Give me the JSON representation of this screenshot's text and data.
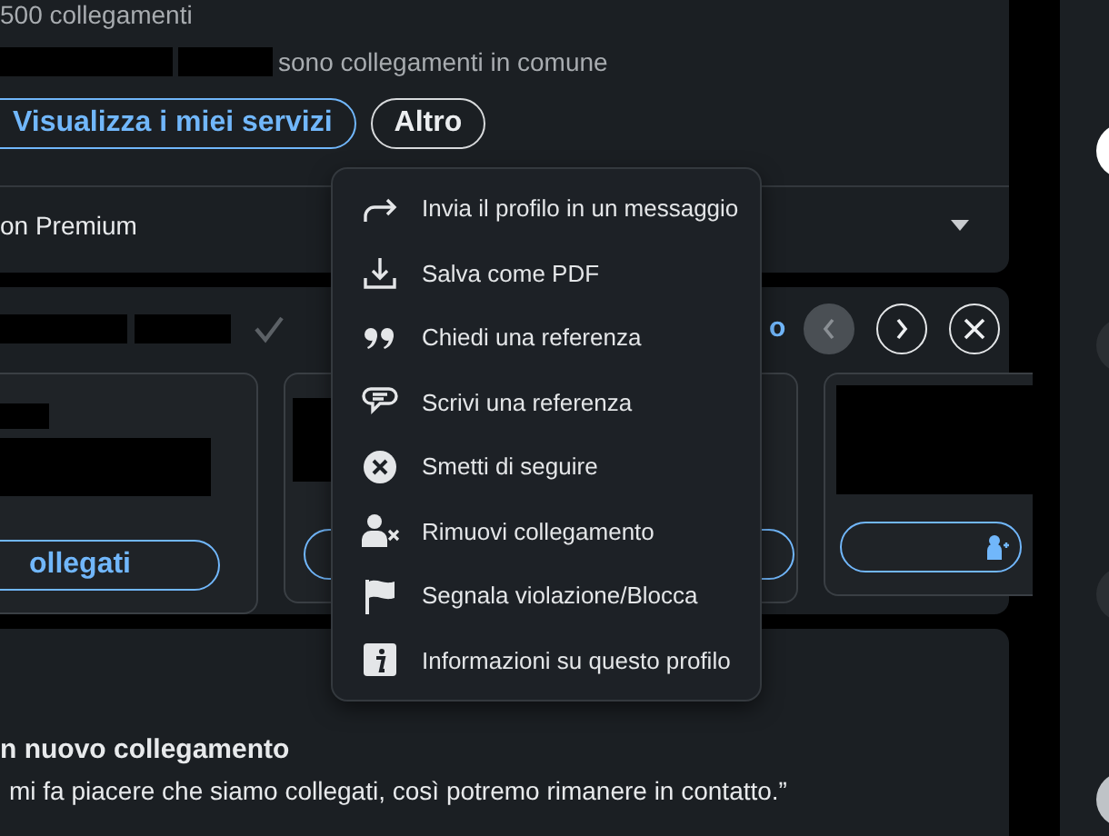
{
  "profile": {
    "connections": "500 collegamenti",
    "mutual_text": "sono collegamenti in comune",
    "buttons": [
      {
        "label": "Visualizza i miei servizi",
        "kind": "primary"
      },
      {
        "label": "Altro",
        "kind": "secondary"
      }
    ],
    "premium_row": "on Premium"
  },
  "suggestions": {
    "header_link": "o",
    "nav": [
      {
        "kind": "prev",
        "disabled": true
      },
      {
        "kind": "next",
        "disabled": false
      },
      {
        "kind": "close",
        "disabled": false
      }
    ],
    "cards": [
      {
        "button": "ollegati"
      }
    ]
  },
  "post": {
    "title": "n nuovo collegamento",
    "quote": "mi fa piacere che siamo collegati, così potremo rimanere in contatto.”"
  },
  "menu": [
    {
      "label": "Invia il profilo in un messaggio"
    },
    {
      "label": "Salva come PDF"
    },
    {
      "label": "Chiedi una referenza"
    },
    {
      "label": "Scrivi una referenza"
    },
    {
      "label": "Smetti di seguire"
    },
    {
      "label": "Rimuovi collegamento"
    },
    {
      "label": "Segnala violazione/Blocca"
    },
    {
      "label": "Informazioni su questo profilo"
    }
  ]
}
